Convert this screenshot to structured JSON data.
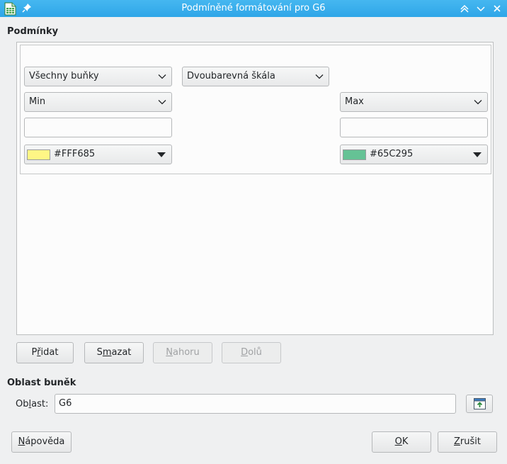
{
  "window": {
    "title": "Podmíněné formátování pro G6"
  },
  "conditions": {
    "section_label": "Podmínky",
    "apply_to_combo": "Všechny buňky",
    "type_combo": "Dvoubarevná škála",
    "min": {
      "type_combo": "Min",
      "value": "",
      "color_label": "#FFF685",
      "color_hex": "#FFF685"
    },
    "max": {
      "type_combo": "Max",
      "value": "",
      "color_label": "#65C295",
      "color_hex": "#65C295"
    }
  },
  "list_buttons": {
    "add": {
      "before": "P",
      "key": "ř",
      "after": "idat"
    },
    "delete": {
      "before": "S",
      "key": "m",
      "after": "azat"
    },
    "up": {
      "before": "",
      "key": "N",
      "after": "ahoru"
    },
    "down": {
      "before": "",
      "key": "D",
      "after": "olů"
    }
  },
  "range": {
    "section_label": "Oblast buněk",
    "label_before": "Ob",
    "label_key": "l",
    "label_after": "ast:",
    "value": "G6"
  },
  "footer": {
    "help": {
      "before": "",
      "key": "N",
      "after": "ápověda"
    },
    "ok": {
      "before": "",
      "key": "O",
      "after": "K"
    },
    "cancel": {
      "before": "",
      "key": "Z",
      "after": "rušit"
    }
  },
  "colors": {
    "titlebar": "#3daee9",
    "window_bg": "#eff0f1"
  }
}
